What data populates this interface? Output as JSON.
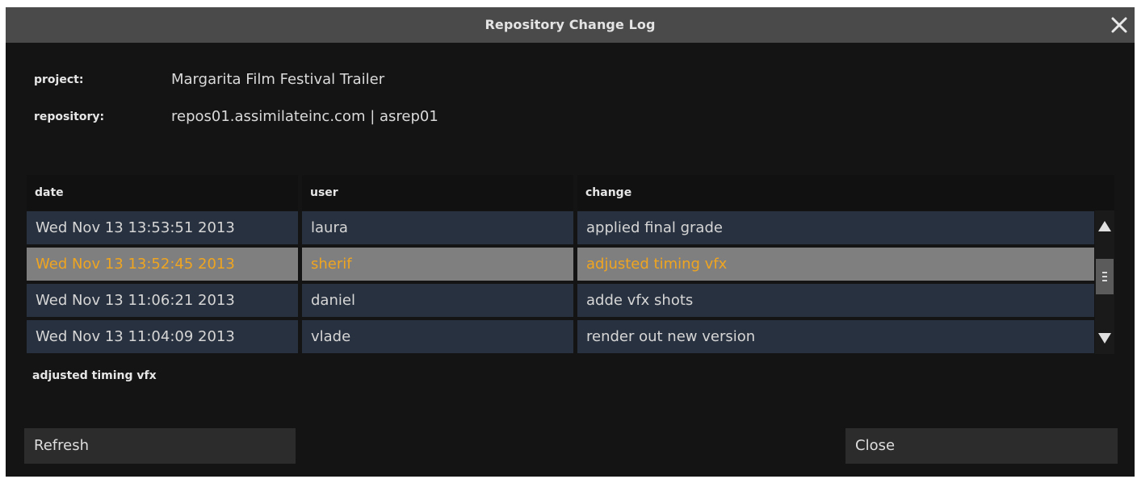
{
  "dialog": {
    "title": "Repository Change Log",
    "close_icon": "close-x-icon"
  },
  "project": {
    "label": "project:",
    "value": "Margarita Film Festival Trailer"
  },
  "repository": {
    "label": "repository:",
    "value": "repos01.assimilateinc.com | asrep01"
  },
  "table": {
    "columns": [
      "date",
      "user",
      "change"
    ],
    "rows": [
      {
        "date": "Wed Nov 13 13:53:51 2013",
        "user": "laura",
        "change": "applied final grade",
        "selected": false
      },
      {
        "date": "Wed Nov 13 13:52:45 2013",
        "user": "sherif",
        "change": "adjusted timing vfx",
        "selected": true
      },
      {
        "date": "Wed Nov 13 11:06:21 2013",
        "user": "daniel",
        "change": "adde vfx shots",
        "selected": false
      },
      {
        "date": "Wed Nov 13 11:04:09 2013",
        "user": "vlade",
        "change": "render out new version",
        "selected": false
      }
    ]
  },
  "selected_description": "adjusted timing vfx",
  "buttons": {
    "refresh": "Refresh",
    "close": "Close"
  },
  "colors": {
    "selected_text": "#f0a520",
    "row_bg": "#28313f",
    "selected_bg": "#7f7f7f",
    "dialog_bg": "#141414",
    "titlebar_bg": "#4a4a4a"
  }
}
